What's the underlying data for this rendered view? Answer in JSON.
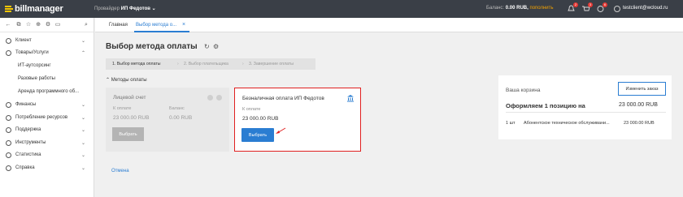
{
  "topbar": {
    "logo_text": "billmanager",
    "provider_label": "Провайдер",
    "provider_name": "ИП Федотов ⌄",
    "balance_label": "Баланс:",
    "balance_value": "0.00 RUB,",
    "balance_action": "пополнить",
    "badges": [
      "2",
      "3",
      "6"
    ],
    "user_email": "testclient@wcloud.ru"
  },
  "sidebar": {
    "items": [
      {
        "label": "Клиент",
        "chevron": "⌄"
      },
      {
        "label": "Товары/Услуги",
        "chevron": "⌃"
      },
      {
        "label": "Финансы",
        "chevron": "⌄"
      },
      {
        "label": "Потребление ресурсов",
        "chevron": "⌄"
      },
      {
        "label": "Поддержка",
        "chevron": "⌄"
      },
      {
        "label": "Инструменты",
        "chevron": "⌄"
      },
      {
        "label": "Статистика",
        "chevron": "⌄"
      },
      {
        "label": "Справка",
        "chevron": "⌄"
      }
    ],
    "subitems": [
      "ИТ-аутсорсинг",
      "Разовые работы",
      "Аренда программного об..."
    ]
  },
  "tabs": {
    "home": "Главная",
    "active": "Выбор метода о...",
    "close": "×"
  },
  "main": {
    "title": "Выбор метода оплаты",
    "steps": [
      "1. Выбор метода оплаты",
      "2. Выбор плательщика",
      "3. Завершение оплаты"
    ],
    "methods_header": "⌃  Методы оплаты",
    "cancel": "Отмена"
  },
  "card_account": {
    "title": "Лицевой счет",
    "to_pay_label": "К оплате",
    "to_pay_value": "23 000.00 RUB",
    "balance_label": "Баланс",
    "balance_value": "0.00 RUB",
    "button": "Выбрать"
  },
  "card_bank": {
    "title": "Безналичная оплата ИП Федотов",
    "to_pay_label": "К оплате",
    "to_pay_value": "23 000.00 RUB",
    "button": "Выбрать"
  },
  "cart": {
    "title": "Ваша корзина",
    "change_button": "Изменить заказ",
    "order_text": "Оформляем 1 позицию на",
    "order_total": "23 000.00 RUB",
    "row_qty": "1 шт",
    "row_name": "Абонентское техническое обслуживани...",
    "row_price": "23 000.00 RUB"
  },
  "colors": {
    "topbar": "#3a3f47",
    "accent": "#2a7dd2",
    "highlight": "#e02020",
    "logo": "#f7c600"
  }
}
